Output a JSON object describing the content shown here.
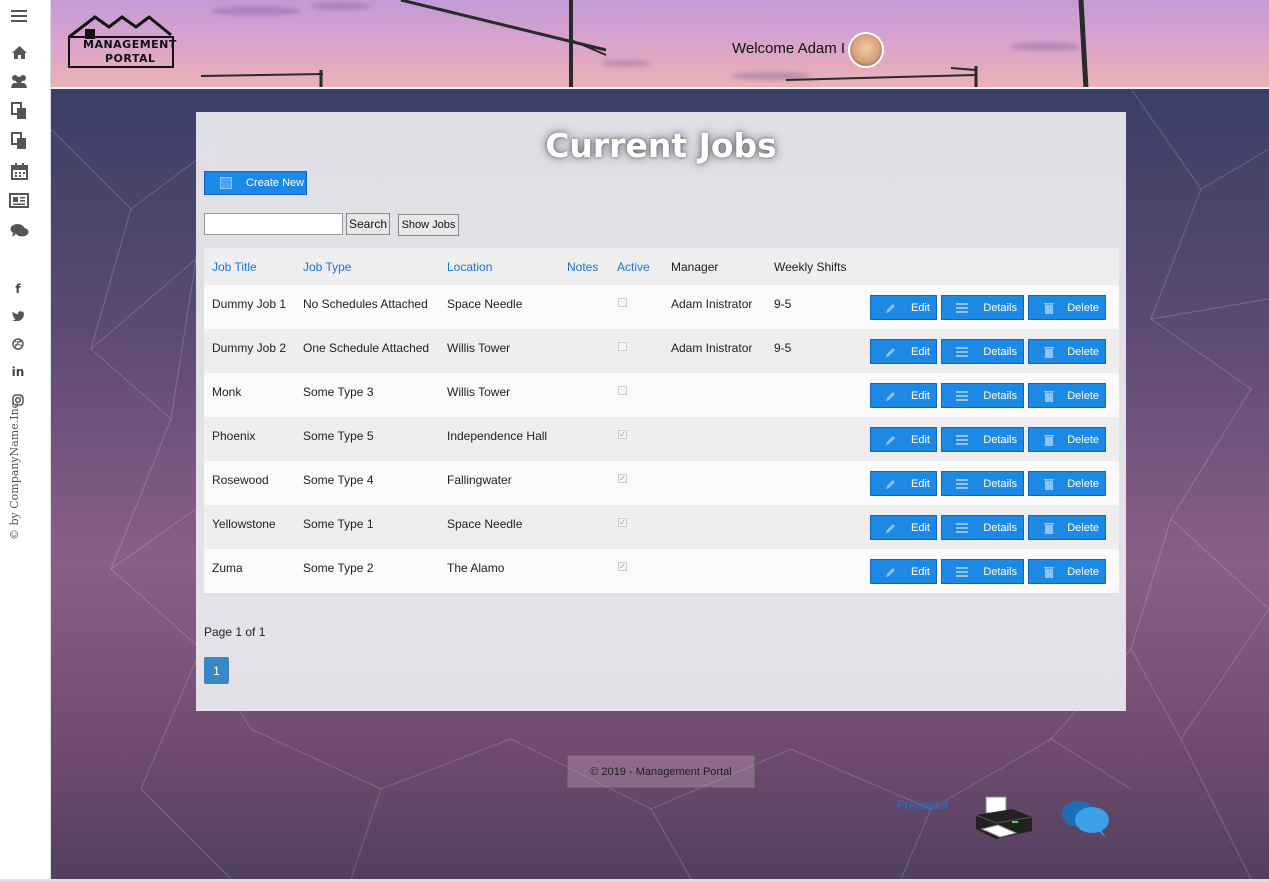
{
  "sidebar": {
    "icons": [
      "menu-icon",
      "home-icon",
      "users-icon",
      "copy-icon",
      "files-icon",
      "calendar-icon",
      "newspaper-icon",
      "comments-icon"
    ],
    "social": [
      "f",
      "t",
      "dribbble",
      "in",
      "instagram"
    ],
    "copyright": "© by CompanyName.Inc"
  },
  "header": {
    "logo_line1": "MANAGEMENT",
    "logo_line2": "PORTAL",
    "welcome": "Welcome Adam I"
  },
  "page": {
    "title": "Current Jobs",
    "create_label": "Create New",
    "search_value": "",
    "search_label": "Search",
    "show_jobs_label": "Show Jobs"
  },
  "table": {
    "headers": {
      "job_title": "Job Title",
      "job_type": "Job Type",
      "location": "Location",
      "notes": "Notes",
      "active": "Active",
      "manager": "Manager",
      "weekly_shifts": "Weekly Shifts"
    },
    "rows": [
      {
        "title": "Dummy Job 1",
        "type": "No Schedules Attached",
        "location": "Space Needle",
        "notes": "",
        "active": false,
        "manager": "Adam Inistrator",
        "shifts": "9-5"
      },
      {
        "title": "Dummy Job 2",
        "type": "One Schedule Attached",
        "location": "Willis Tower",
        "notes": "",
        "active": false,
        "manager": "Adam Inistrator",
        "shifts": "9-5"
      },
      {
        "title": "Monk",
        "type": "Some Type 3",
        "location": "Willis Tower",
        "notes": "",
        "active": false,
        "manager": "",
        "shifts": ""
      },
      {
        "title": "Phoenix",
        "type": "Some Type 5",
        "location": "Independence Hall",
        "notes": "",
        "active": true,
        "manager": "",
        "shifts": ""
      },
      {
        "title": "Rosewood",
        "type": "Some Type 4",
        "location": "Fallingwater",
        "notes": "",
        "active": true,
        "manager": "",
        "shifts": ""
      },
      {
        "title": "Yellowstone",
        "type": "Some Type 1",
        "location": "Space Needle",
        "notes": "",
        "active": true,
        "manager": "",
        "shifts": ""
      },
      {
        "title": "Zuma",
        "type": "Some Type 2",
        "location": "The Alamo",
        "notes": "",
        "active": true,
        "manager": "",
        "shifts": ""
      }
    ],
    "edit_label": "Edit",
    "details_label": "Details",
    "delete_label": "Delete"
  },
  "pagination": {
    "info": "Page 1 of 1",
    "current": "1"
  },
  "footer": {
    "text": "© 2019 - Management Portal",
    "preloader": "Preloader"
  },
  "colors": {
    "accent": "#1e88e5",
    "link": "#1976d2",
    "page_button": "#3a87c8"
  }
}
